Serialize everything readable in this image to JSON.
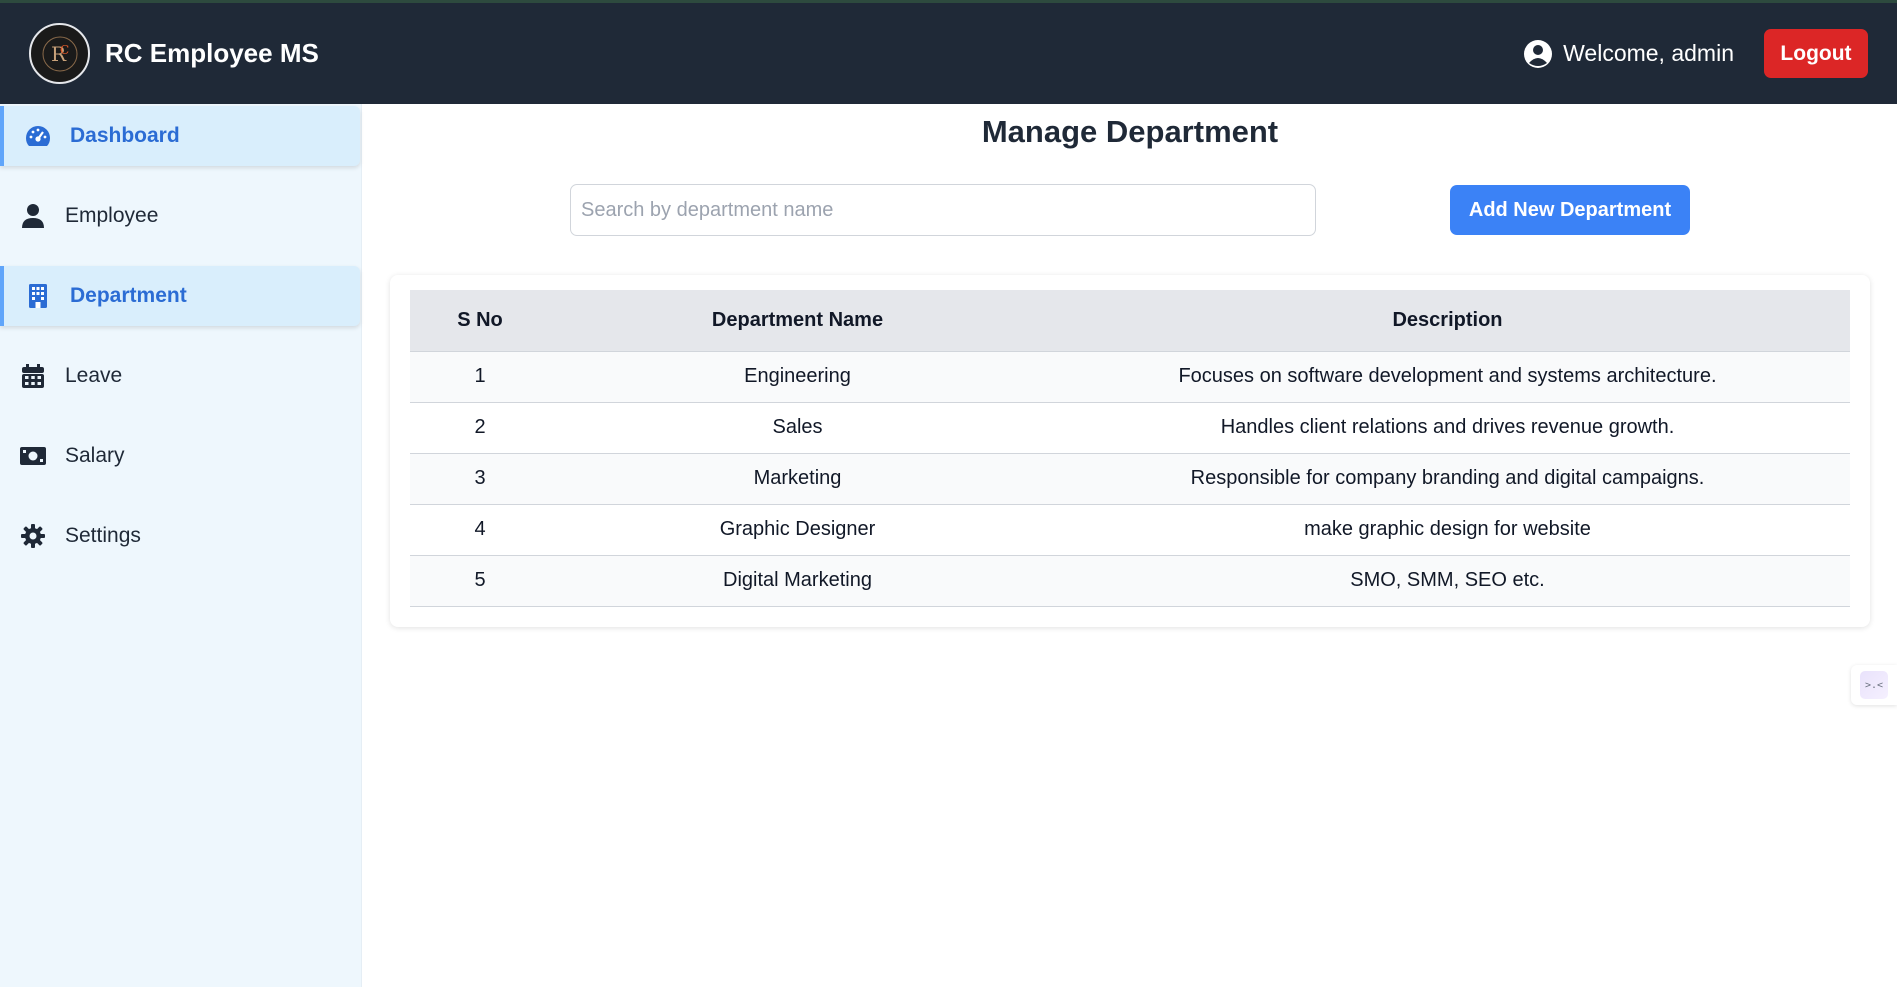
{
  "header": {
    "brand_title": "RC Employee MS",
    "welcome_text": "Welcome, admin",
    "logout_label": "Logout"
  },
  "sidebar": {
    "items": [
      {
        "label": "Dashboard",
        "icon": "gauge-icon",
        "active": true
      },
      {
        "label": "Employee",
        "icon": "user-icon",
        "active": false
      },
      {
        "label": "Department",
        "icon": "building-icon",
        "active": true
      },
      {
        "label": "Leave",
        "icon": "calendar-icon",
        "active": false
      },
      {
        "label": "Salary",
        "icon": "money-bill-icon",
        "active": false
      },
      {
        "label": "Settings",
        "icon": "gear-icon",
        "active": false
      }
    ]
  },
  "main": {
    "title": "Manage Department",
    "search_placeholder": "Search by department name",
    "add_button_label": "Add New Department",
    "table": {
      "headers": [
        "S No",
        "Department Name",
        "Description"
      ],
      "rows": [
        {
          "sno": "1",
          "name": "Engineering",
          "description": "Focuses on software development and systems architecture."
        },
        {
          "sno": "2",
          "name": "Sales",
          "description": "Handles client relations and drives revenue growth."
        },
        {
          "sno": "3",
          "name": "Marketing",
          "description": "Responsible for company branding and digital campaigns."
        },
        {
          "sno": "4",
          "name": "Graphic Designer",
          "description": "make graphic design for website"
        },
        {
          "sno": "5",
          "name": "Digital Marketing",
          "description": "SMO, SMM, SEO etc."
        }
      ]
    }
  },
  "floating_widget": {
    "glyph": ">.<"
  },
  "colors": {
    "header_bg": "#1f2937",
    "sidebar_bg": "#eef7fd",
    "active_item_bg": "#d9eefc",
    "active_text": "#2b6cd4",
    "logout_bg": "#dc2626",
    "primary_button": "#3b82f6"
  }
}
